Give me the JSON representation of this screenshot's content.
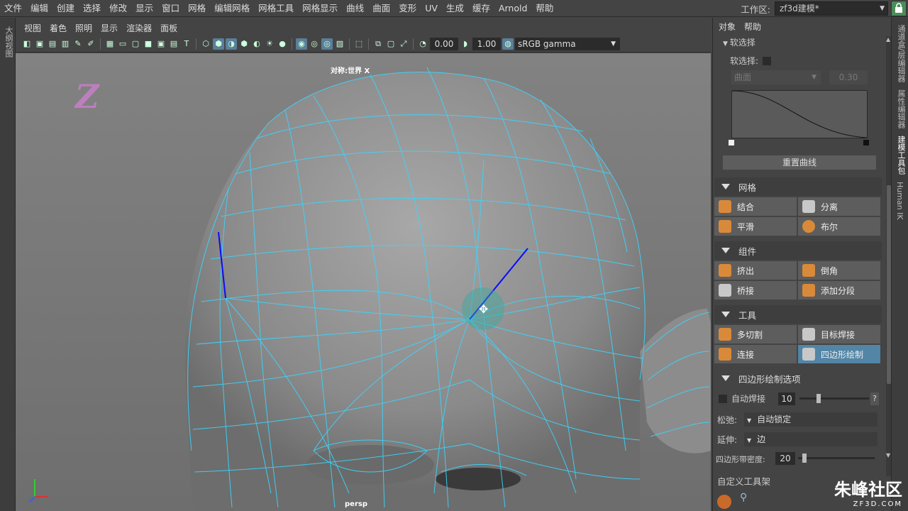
{
  "menubar": {
    "items": [
      "文件",
      "编辑",
      "创建",
      "选择",
      "修改",
      "显示",
      "窗口",
      "网格",
      "编辑网格",
      "网格工具",
      "网格显示",
      "曲线",
      "曲面",
      "变形",
      "UV",
      "生成",
      "缓存",
      "Arnold",
      "帮助"
    ],
    "workspace_label": "工作区:",
    "workspace_value": "zf3d建模*"
  },
  "left_tab": {
    "label": "大纲视图"
  },
  "viewport": {
    "menu": [
      "视图",
      "着色",
      "照明",
      "显示",
      "渲染器",
      "面板"
    ],
    "toolbar": {
      "value1": "0.00",
      "value2": "1.00",
      "color_space": "sRGB gamma"
    },
    "symmetry_label": "对称:世界 X",
    "camera_label": "persp",
    "logo_text": "Z"
  },
  "right_panel": {
    "menu": [
      "对象",
      "帮助"
    ],
    "soft_select_header": "软选择",
    "soft_select_label": "软选择:",
    "falloff_mode": "曲面",
    "falloff_value": "0.30",
    "reset_curve": "重置曲线",
    "sections": {
      "mesh": {
        "title": "网格",
        "buttons": [
          "结合",
          "分离",
          "平滑",
          "布尔"
        ]
      },
      "components": {
        "title": "组件",
        "buttons": [
          "挤出",
          "倒角",
          "桥接",
          "添加分段"
        ]
      },
      "tools": {
        "title": "工具",
        "buttons": [
          "多切割",
          "目标焊接",
          "连接",
          "四边形绘制"
        ]
      }
    },
    "quad_options": {
      "title": "四边形绘制选项",
      "auto_weld_label": "自动焊接",
      "auto_weld_value": "10",
      "help": "?",
      "relax_label": "松弛:",
      "relax_value": "自动锁定",
      "extend_label": "延伸:",
      "extend_value": "边",
      "density_label": "四边形带密度:",
      "density_value": "20"
    },
    "custom_shelf": "自定义工具架"
  },
  "right_tabs": [
    "通道盒/层编辑器",
    "属性编辑器",
    "建模工具包",
    "Human IK"
  ],
  "watermark": {
    "brand": "朱峰社区",
    "url": "ZF3D.COM"
  },
  "colors": {
    "accent": "#5285a6",
    "wire": "#3ad6ff",
    "selected_edge": "#0a0aff"
  }
}
